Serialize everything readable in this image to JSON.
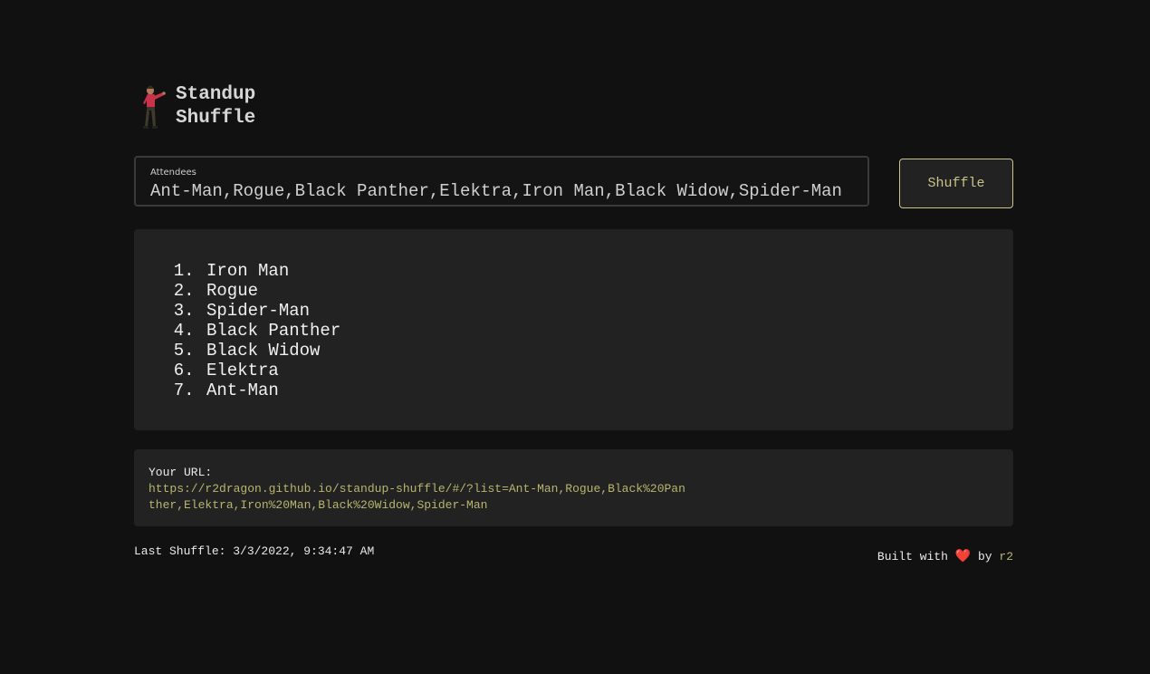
{
  "app": {
    "title_line1": "Standup",
    "title_line2": "Shuffle"
  },
  "attendees": {
    "label": "Attendees",
    "value": "Ant-Man,Rogue,Black Panther,Elektra,Iron Man,Black Widow,Spider-Man"
  },
  "shuffle_button": "Shuffle",
  "order": [
    "Iron Man",
    "Rogue",
    "Spider-Man",
    "Black Panther",
    "Black Widow",
    "Elektra",
    "Ant-Man"
  ],
  "url": {
    "label": "Your URL:",
    "link": "https://r2dragon.github.io/standup-shuffle/#/?list=Ant-Man,Rogue,Black%20Panther,Elektra,Iron%20Man,Black%20Widow,Spider-Man"
  },
  "last_shuffle": "Last Shuffle: 3/3/2022, 9:34:47 AM",
  "footer": {
    "built_with": "Built with",
    "heart": "❤️",
    "by": "by",
    "author": "r2"
  },
  "colors": {
    "background": "#111111",
    "panel": "#222222",
    "accent": "#c9c48a",
    "link": "#b9b56e"
  }
}
